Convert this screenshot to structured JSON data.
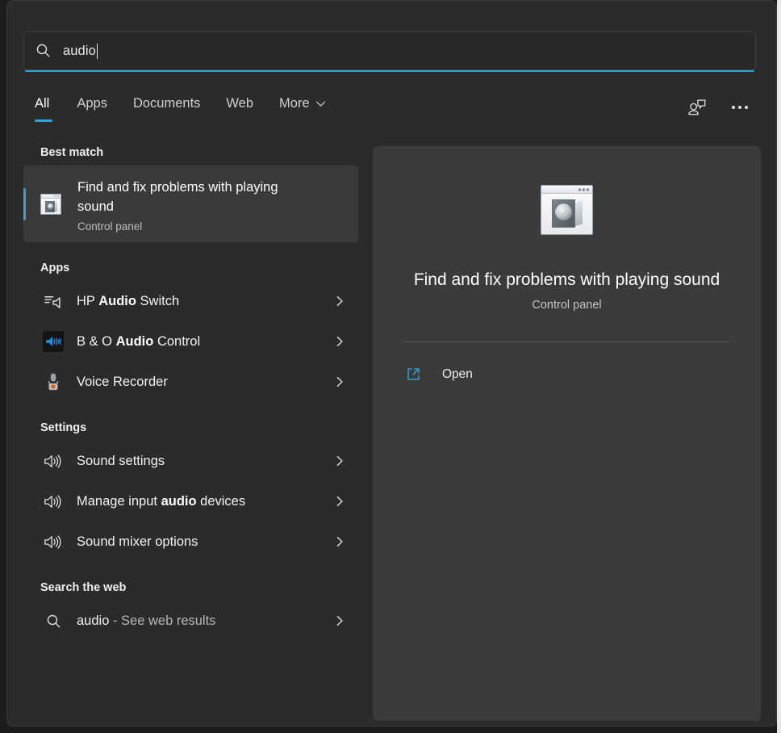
{
  "search": {
    "value": "audio",
    "icon": "search-icon"
  },
  "tabs": [
    {
      "label": "All",
      "active": true
    },
    {
      "label": "Apps",
      "active": false
    },
    {
      "label": "Documents",
      "active": false
    },
    {
      "label": "Web",
      "active": false
    },
    {
      "label": "More",
      "active": false,
      "icon": "chevron-down-icon"
    }
  ],
  "top_actions": [
    {
      "name": "feedback-icon",
      "label": "Feedback"
    },
    {
      "name": "more-options-icon",
      "label": "More options"
    }
  ],
  "groups": {
    "best_match": {
      "header": "Best match",
      "item": {
        "title": "Find and fix problems with playing sound",
        "subtitle": "Control panel",
        "icon": "troubleshooter-sound-icon",
        "selected": true
      }
    },
    "apps": {
      "header": "Apps",
      "items": [
        {
          "prefix": "HP ",
          "match": "Audio",
          "suffix": " Switch",
          "icon": "hp-audio-switch-icon"
        },
        {
          "prefix": "B & O ",
          "match": "Audio",
          "suffix": " Control",
          "icon": "bo-audio-control-icon"
        },
        {
          "prefix": "Voice Recorder",
          "match": "",
          "suffix": "",
          "icon": "voice-recorder-icon"
        }
      ]
    },
    "settings": {
      "header": "Settings",
      "items": [
        {
          "prefix": "Sound settings",
          "match": "",
          "suffix": "",
          "icon": "speaker-icon"
        },
        {
          "prefix": "Manage input ",
          "match": "audio",
          "suffix": " devices",
          "icon": "speaker-icon"
        },
        {
          "prefix": "Sound mixer options",
          "match": "",
          "suffix": "",
          "icon": "speaker-icon"
        }
      ]
    },
    "web": {
      "header": "Search the web",
      "items": [
        {
          "prefix": "audio",
          "match": "",
          "suffix": " - See web results",
          "icon": "search-icon"
        }
      ]
    }
  },
  "preview": {
    "icon": "troubleshooter-sound-icon",
    "title": "Find and fix problems with playing sound",
    "subtitle": "Control panel",
    "actions": [
      {
        "label": "Open",
        "icon": "open-external-icon"
      }
    ]
  },
  "colors": {
    "accent": "#2fa3e0",
    "window_bg": "#2b2b2b",
    "preview_bg": "#3b3b3b",
    "selected_row_bg": "#3a3a3a",
    "text_primary": "#ffffff",
    "text_secondary": "#bdbdbd"
  }
}
